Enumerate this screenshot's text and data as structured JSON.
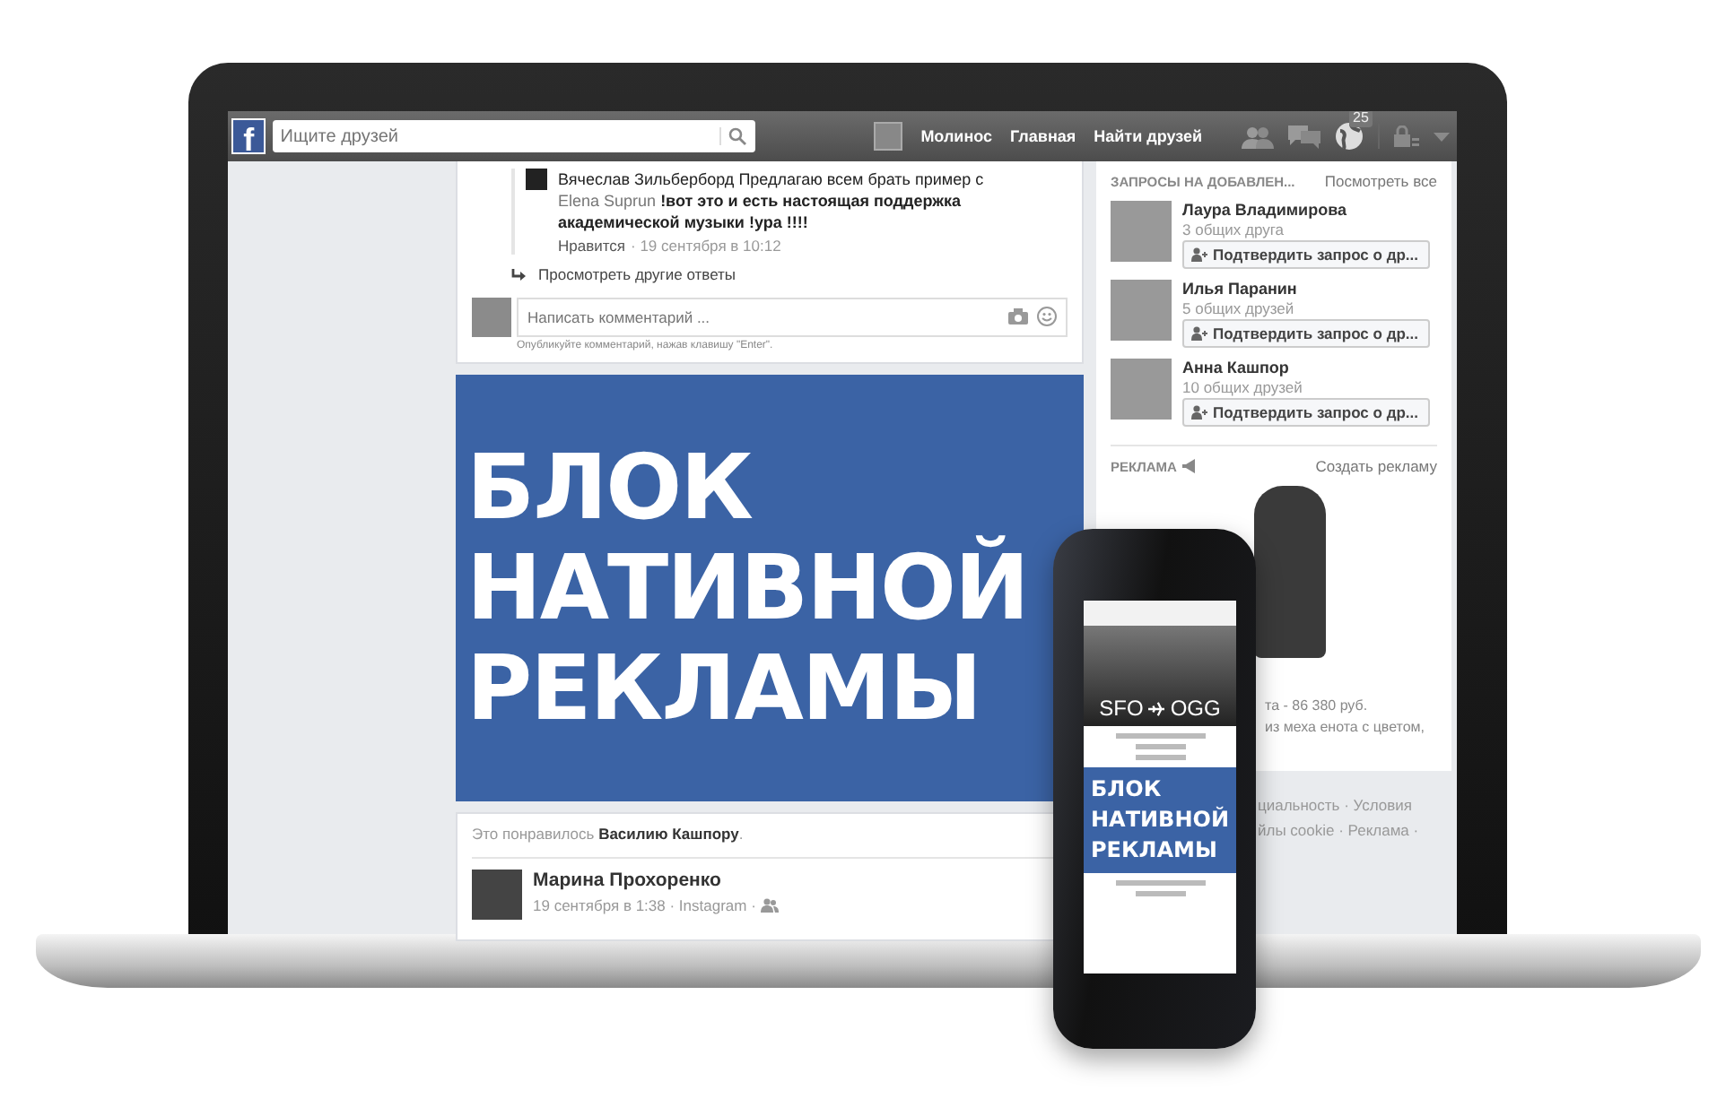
{
  "topbar": {
    "logo": "f",
    "search_placeholder": "Ищите друзей",
    "profile": "Молинос",
    "nav": [
      "Главная",
      "Найти друзей"
    ],
    "notification_count": "25"
  },
  "reply": {
    "author": "Вячеслав Зильберборд",
    "text_before": "Предлагаю всем брать пример с",
    "mention": "Elena Suprun",
    "text_after": "!вот это и есть настоящая поддержка академической музыки !ура !!!!",
    "like": "Нравится",
    "time": "· 19 сентября в 10:12"
  },
  "more_replies": "Просмотреть другие ответы",
  "comment": {
    "placeholder": "Написать комментарий ...",
    "hint": "Опубликуйте комментарий, нажав клавишу \"Enter\"."
  },
  "native_ad": {
    "lines": [
      "БЛОК",
      "НАТИВНОЙ",
      "РЕКЛАМЫ"
    ]
  },
  "likes": "Это понравилось **Василию Кашпору**.",
  "post": {
    "author": "Марина Прохоренко",
    "meta": "19 сентября в 1:38 · Instagram ·"
  },
  "friend_requests": {
    "title": "ЗАПРОСЫ НА ДОБАВЛЕН...",
    "see_all": "Посмотреть все",
    "items": [
      {
        "name": "Лаура Владимирова",
        "mutual": "3 общих друга",
        "button": "Подтвердить запрос о др..."
      },
      {
        "name": "Илья Паранин",
        "mutual": "5 общих друзей",
        "button": "Подтвердить запрос о др..."
      },
      {
        "name": "Анна Кашпор",
        "mutual": "10 общих друзей",
        "button": "Подтвердить запрос о др..."
      }
    ]
  },
  "ads": {
    "title": "РЕКЛАМА",
    "create": "Создать рекламу",
    "lines": [
      "та - 86 380 руб.",
      "из меха енота с цветом,"
    ]
  },
  "footer": [
    "циальность · Условия",
    "йлы cookie · Реклама ·"
  ],
  "phone": {
    "route_from": "SFO",
    "route_to": "OGG",
    "ad_lines": [
      "БЛОК",
      "НАТИВНОЙ",
      "РЕКЛАМЫ"
    ]
  }
}
